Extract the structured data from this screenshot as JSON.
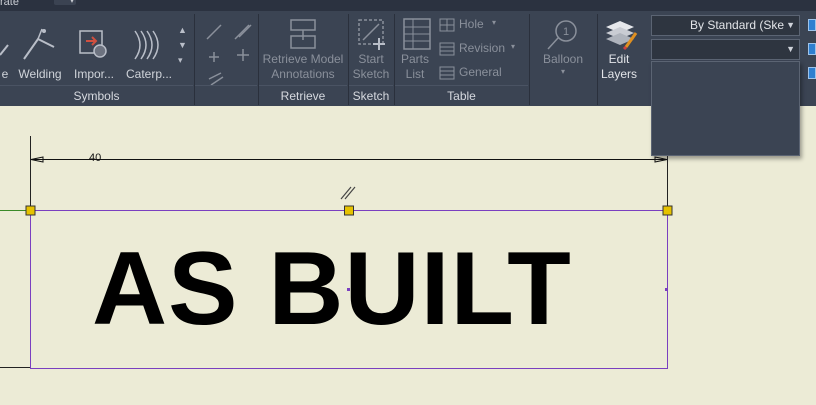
{
  "topbar": {
    "partial_text": "rate"
  },
  "ribbon": {
    "symbols": {
      "label": "Symbols",
      "tools": [
        {
          "label": "e"
        },
        {
          "label": "Welding"
        },
        {
          "label": "Impor..."
        },
        {
          "label": "Caterp..."
        }
      ]
    },
    "retrieve": {
      "label": "Retrieve",
      "tool_line1": "Retrieve Model",
      "tool_line2": "Annotations"
    },
    "sketch": {
      "label": "Sketch",
      "tool_line1": "Start",
      "tool_line2": "Sketch"
    },
    "table": {
      "label": "Table",
      "parts_list_line1": "Parts",
      "parts_list_line2": "List",
      "hole": "Hole",
      "revision": "Revision",
      "general": "General"
    },
    "balloon": {
      "label": "Balloon",
      "number": "1"
    },
    "layers": {
      "edit_line1": "Edit",
      "edit_line2": "Layers"
    },
    "style_dropdown": {
      "value": "By Standard (Ske"
    },
    "layer_dropdown": {
      "value": ""
    }
  },
  "canvas": {
    "dimension_value": "40",
    "text_note": "AS BUILT"
  },
  "colors": {
    "ribbon_bg": "#3b4453",
    "canvas_bg": "#ecebd6",
    "grip": "#e6c200",
    "selection_line": "#3a8a28",
    "boundary": "#7a3fc0"
  }
}
